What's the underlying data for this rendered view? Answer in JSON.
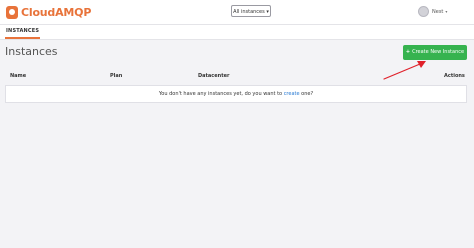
{
  "brand": {
    "name": "CloudAMQP"
  },
  "header": {
    "instance_select": "All instances ▾",
    "user_name": "Nest",
    "user_caret": "▾"
  },
  "nav": {
    "tabs": [
      {
        "label": "INSTANCES",
        "active": true
      }
    ]
  },
  "main": {
    "title": "Instances",
    "create_button": {
      "icon": "+",
      "label": "Create New Instance"
    },
    "table": {
      "columns": [
        "Name",
        "Plan",
        "Datacenter",
        "Actions"
      ],
      "empty_before": "You don't have any instances yet, do you want to ",
      "empty_link": "create",
      "empty_after": " one?"
    }
  },
  "colors": {
    "accent": "#e8733a",
    "primary": "#36b34f",
    "link": "#2a7bd3",
    "annotation": "#e0202a"
  }
}
